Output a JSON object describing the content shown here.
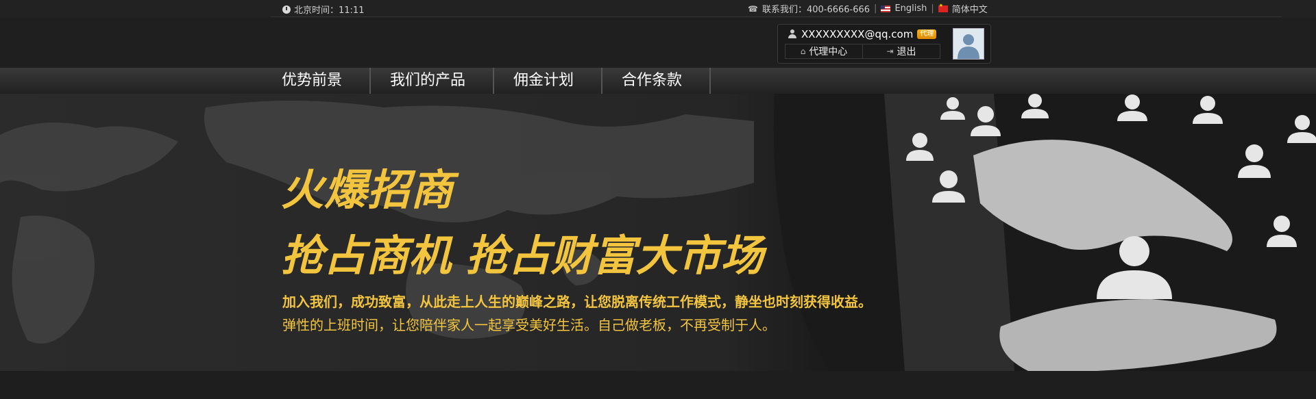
{
  "topbar": {
    "time_label": "北京时间：11:11",
    "contact_label": "联系我们：400-6666-666",
    "english_label": "English",
    "chinese_label": "简体中文",
    "separator": "|"
  },
  "user": {
    "email": "XXXXXXXXX@qq.com",
    "badge": "代理",
    "agent_center": "代理中心",
    "logout": "退出"
  },
  "nav": {
    "items": [
      {
        "label": "优势前景"
      },
      {
        "label": "我们的产品"
      },
      {
        "label": "佣金计划"
      },
      {
        "label": "合作条款"
      }
    ]
  },
  "banner": {
    "headline": "火爆招商",
    "subheadline": "抢占商机 抢占财富大市场",
    "desc1": "加入我们，成功致富，从此走上人生的巅峰之路，让您脱离传统工作模式，静坐也时刻获得收益。",
    "desc2": "弹性的上班时间，让您陪伴家人一起享受美好生活。自己做老板，不再受制于人。"
  },
  "colors": {
    "accent_yellow": "#f3c53f",
    "badge_orange": "#f0a010",
    "background": "#1e1e1e"
  },
  "icons": [
    "clock-icon",
    "phone-icon",
    "us-flag-icon",
    "cn-flag-icon",
    "user-icon",
    "home-icon",
    "exit-icon"
  ]
}
